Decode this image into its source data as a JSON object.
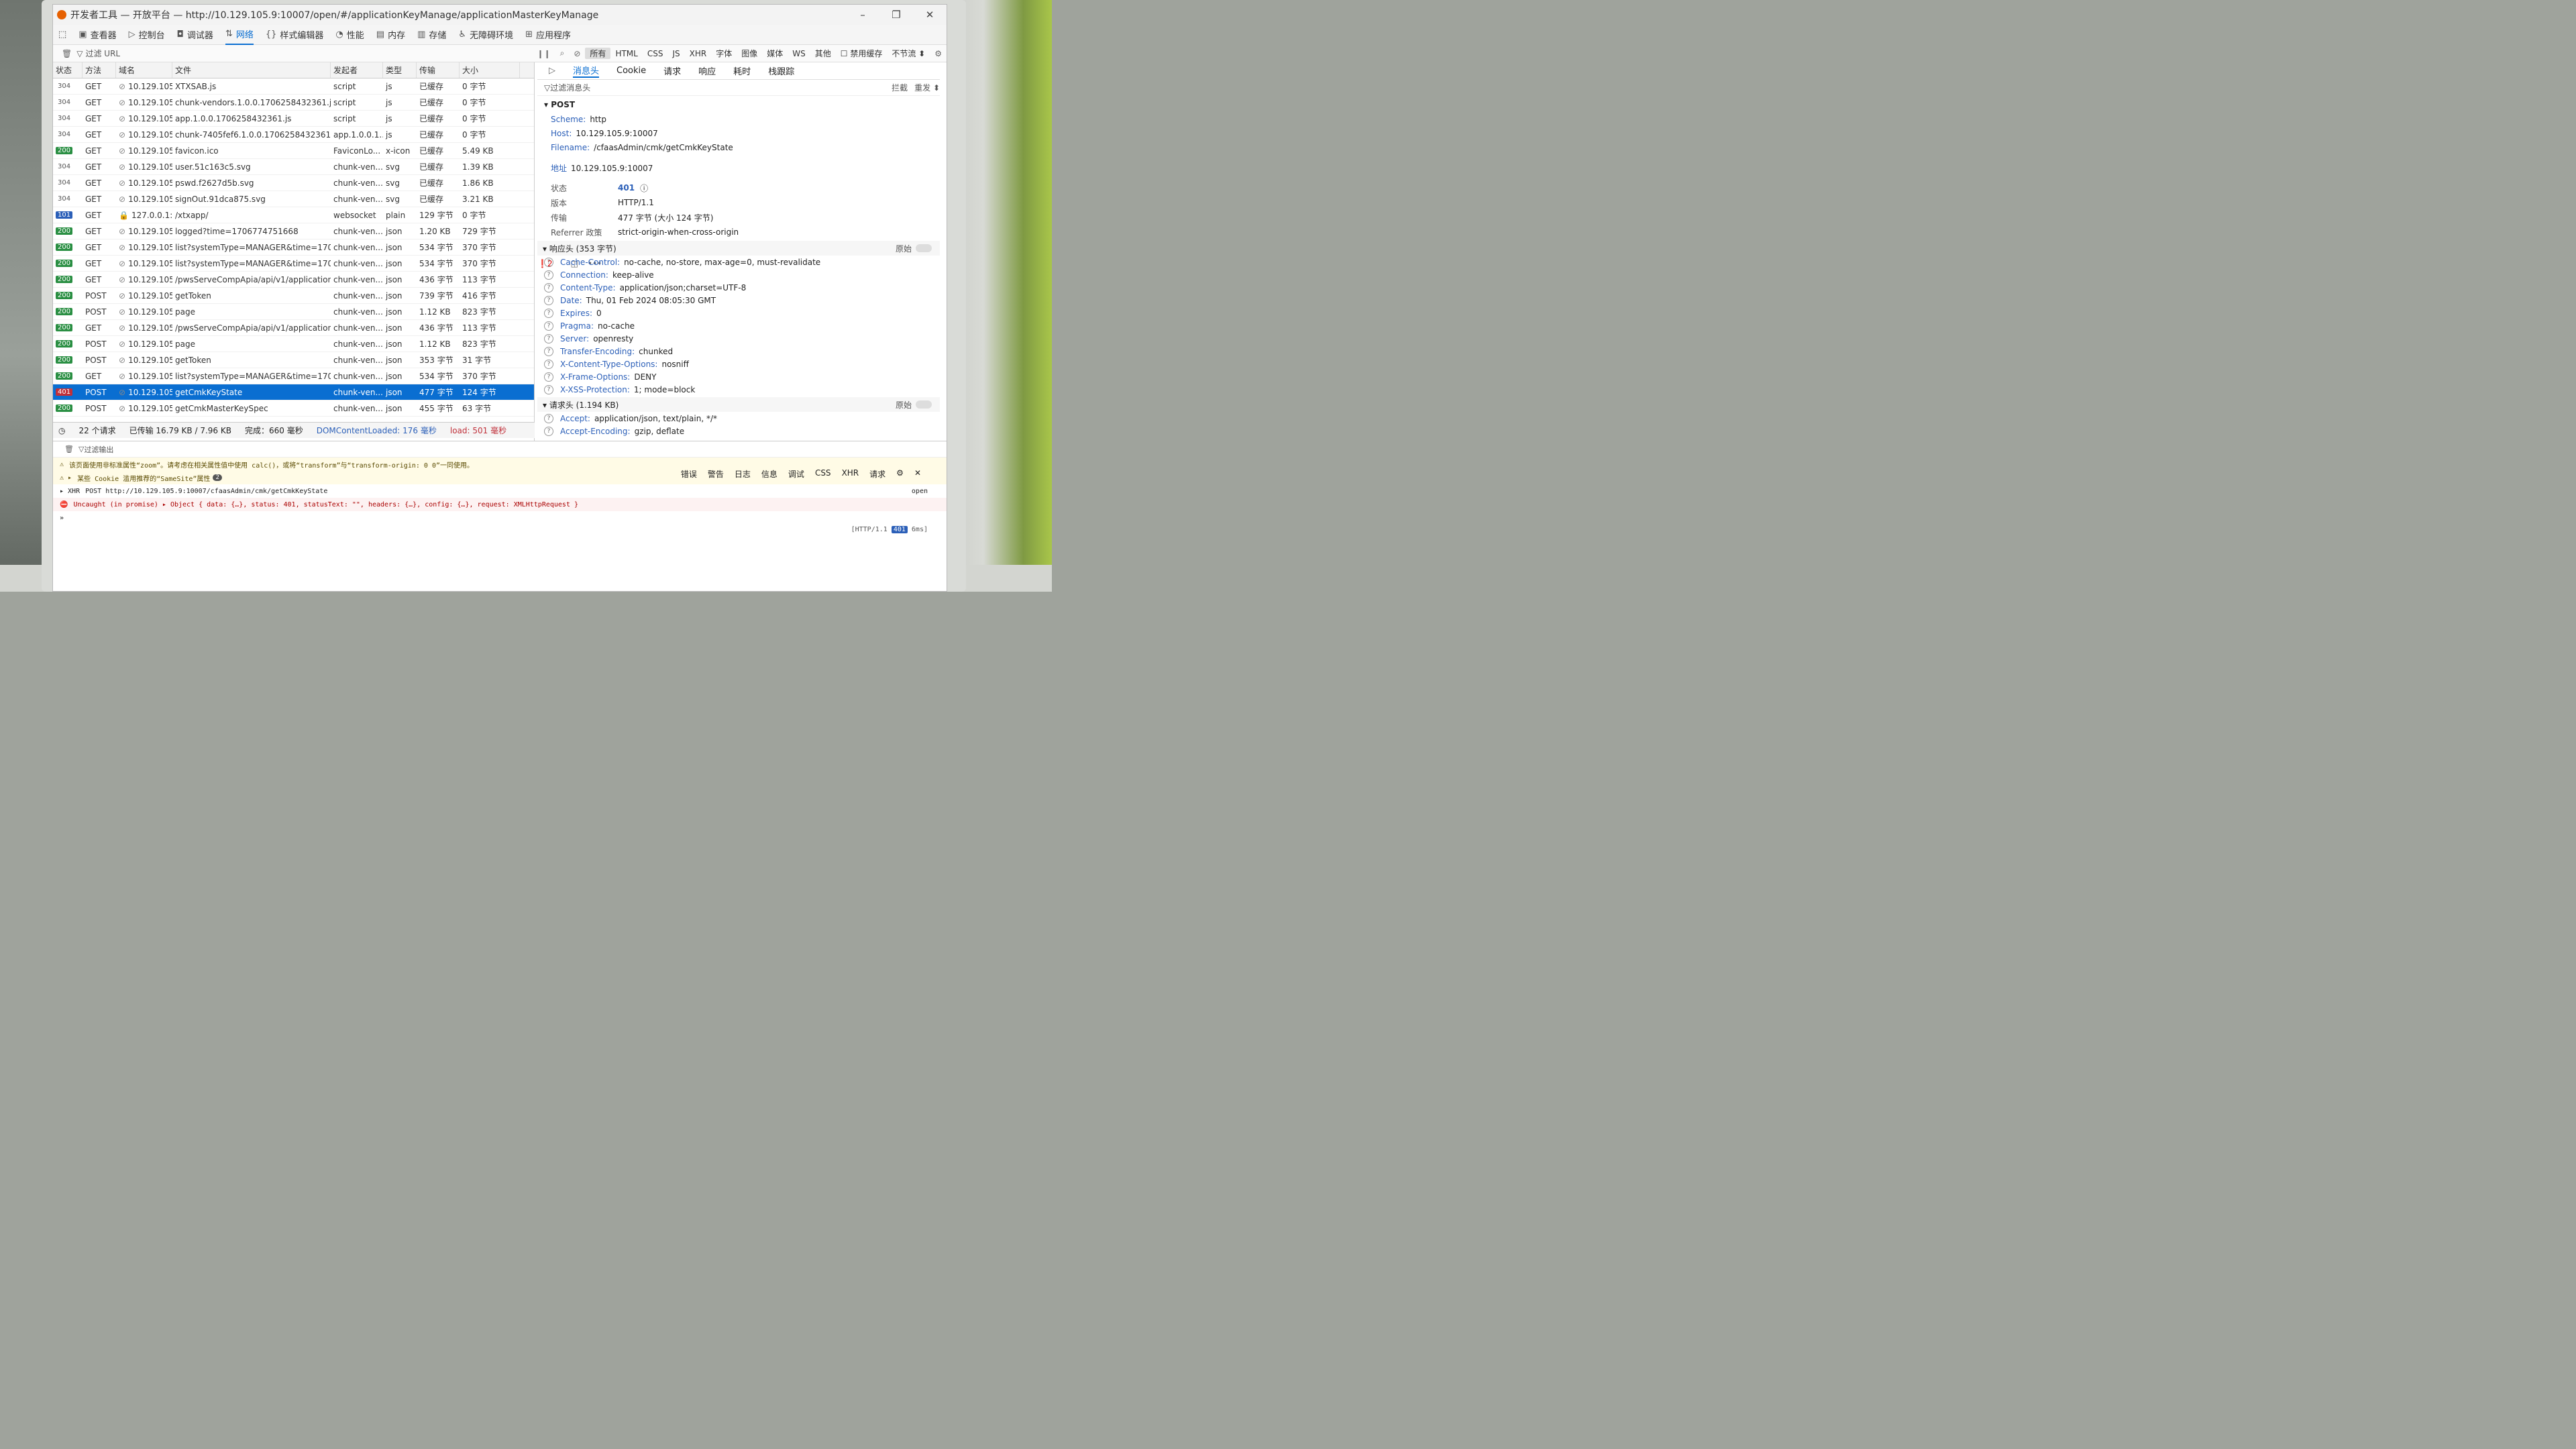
{
  "window": {
    "title": "开发者工具 — 开放平台 — http://10.129.105.9:10007/open/#/applicationKeyManage/applicationMasterKeyManage"
  },
  "toolbar": {
    "tools": [
      "查看器",
      "控制台",
      "调试器",
      "网络",
      "样式编辑器",
      "性能",
      "内存",
      "存储",
      "无障碍环境",
      "应用程序"
    ],
    "active": "网络",
    "error_count": "2"
  },
  "filterbar": {
    "placeholder": "过滤 URL",
    "types": [
      "所有",
      "HTML",
      "CSS",
      "JS",
      "XHR",
      "字体",
      "图像",
      "媒体",
      "WS",
      "其他"
    ],
    "disable_cache": "禁用缓存",
    "throttle": "不节流 ⬍"
  },
  "table": {
    "headers": [
      "状态",
      "方法",
      "域名",
      "文件",
      "发起者",
      "类型",
      "传输",
      "大小"
    ],
    "rows": [
      {
        "status": "304",
        "method": "GET",
        "domain": "10.129.105....",
        "file": "XTXSAB.js",
        "initiator": "script",
        "type": "js",
        "transfer": "已缓存",
        "size": "0 字节"
      },
      {
        "status": "304",
        "method": "GET",
        "domain": "10.129.105....",
        "file": "chunk-vendors.1.0.0.1706258432361.js",
        "initiator": "script",
        "type": "js",
        "transfer": "已缓存",
        "size": "0 字节"
      },
      {
        "status": "304",
        "method": "GET",
        "domain": "10.129.105....",
        "file": "app.1.0.0.1706258432361.js",
        "initiator": "script",
        "type": "js",
        "transfer": "已缓存",
        "size": "0 字节"
      },
      {
        "status": "304",
        "method": "GET",
        "domain": "10.129.105....",
        "file": "chunk-7405fef6.1.0.0.1706258432361.js",
        "initiator": "app.1.0.0.1...",
        "type": "js",
        "transfer": "已缓存",
        "size": "0 字节"
      },
      {
        "status": "200",
        "method": "GET",
        "domain": "10.129.105....",
        "file": "favicon.ico",
        "initiator": "FaviconLo...",
        "type": "x-icon",
        "transfer": "已缓存",
        "size": "5.49 KB"
      },
      {
        "status": "304",
        "method": "GET",
        "domain": "10.129.105....",
        "file": "user.51c163c5.svg",
        "initiator": "chunk-ven...",
        "type": "svg",
        "transfer": "已缓存",
        "size": "1.39 KB"
      },
      {
        "status": "304",
        "method": "GET",
        "domain": "10.129.105....",
        "file": "pswd.f2627d5b.svg",
        "initiator": "chunk-ven...",
        "type": "svg",
        "transfer": "已缓存",
        "size": "1.86 KB"
      },
      {
        "status": "304",
        "method": "GET",
        "domain": "10.129.105....",
        "file": "signOut.91dca875.svg",
        "initiator": "chunk-ven...",
        "type": "svg",
        "transfer": "已缓存",
        "size": "3.21 KB"
      },
      {
        "status": "101",
        "method": "GET",
        "domain": "127.0.0.1:2...",
        "file": "/xtxapp/",
        "initiator": "websocket",
        "type": "plain",
        "transfer": "129 字节",
        "size": "0 字节"
      },
      {
        "status": "200",
        "method": "GET",
        "domain": "10.129.105....",
        "file": "logged?time=1706774751668",
        "initiator": "chunk-ven...",
        "type": "json",
        "transfer": "1.20 KB",
        "size": "729 字节"
      },
      {
        "status": "200",
        "method": "GET",
        "domain": "10.129.105....",
        "file": "list?systemType=MANAGER&time=1706774",
        "initiator": "chunk-ven...",
        "type": "json",
        "transfer": "534 字节",
        "size": "370 字节"
      },
      {
        "status": "200",
        "method": "GET",
        "domain": "10.129.105....",
        "file": "list?systemType=MANAGER&time=1706774",
        "initiator": "chunk-ven...",
        "type": "json",
        "transfer": "534 字节",
        "size": "370 字节"
      },
      {
        "status": "200",
        "method": "GET",
        "domain": "10.129.105....",
        "file": "/pwsServeCompApia/api/v1/application_ms",
        "initiator": "chunk-ven...",
        "type": "json",
        "transfer": "436 字节",
        "size": "113 字节"
      },
      {
        "status": "200",
        "method": "POST",
        "domain": "10.129.105....",
        "file": "getToken",
        "initiator": "chunk-ven...",
        "type": "json",
        "transfer": "739 字节",
        "size": "416 字节"
      },
      {
        "status": "200",
        "method": "POST",
        "domain": "10.129.105....",
        "file": "page",
        "initiator": "chunk-ven...",
        "type": "json",
        "transfer": "1.12 KB",
        "size": "823 字节"
      },
      {
        "status": "200",
        "method": "GET",
        "domain": "10.129.105....",
        "file": "/pwsServeCompApia/api/v1/application_ms",
        "initiator": "chunk-ven...",
        "type": "json",
        "transfer": "436 字节",
        "size": "113 字节"
      },
      {
        "status": "200",
        "method": "POST",
        "domain": "10.129.105....",
        "file": "page",
        "initiator": "chunk-ven...",
        "type": "json",
        "transfer": "1.12 KB",
        "size": "823 字节"
      },
      {
        "status": "200",
        "method": "POST",
        "domain": "10.129.105....",
        "file": "getToken",
        "initiator": "chunk-ven...",
        "type": "json",
        "transfer": "353 字节",
        "size": "31 字节"
      },
      {
        "status": "200",
        "method": "GET",
        "domain": "10.129.105....",
        "file": "list?systemType=MANAGER&time=1706774",
        "initiator": "chunk-ven...",
        "type": "json",
        "transfer": "534 字节",
        "size": "370 字节"
      },
      {
        "status": "401",
        "method": "POST",
        "domain": "10.129.105....",
        "file": "getCmkKeyState",
        "initiator": "chunk-ven...",
        "type": "json",
        "transfer": "477 字节",
        "size": "124 字节"
      },
      {
        "status": "200",
        "method": "POST",
        "domain": "10.129.105....",
        "file": "getCmkMasterKeySpec",
        "initiator": "chunk-ven...",
        "type": "json",
        "transfer": "455 字节",
        "size": "63 字节"
      }
    ],
    "selected_index": 19
  },
  "summary": {
    "requests": "22 个请求",
    "transferred": "已传输 16.79 KB / 7.96 KB",
    "finish": "完成：660 毫秒",
    "dcl": "DOMContentLoaded: 176 毫秒",
    "load": "load: 501 毫秒"
  },
  "details": {
    "tabs": [
      "消息头",
      "Cookie",
      "请求",
      "响应",
      "耗时",
      "栈跟踪"
    ],
    "active": "消息头",
    "filter_placeholder": "过滤消息头",
    "block": "拦截",
    "resend": "重发 ⬍",
    "method": "POST",
    "scheme_k": "Scheme:",
    "scheme": "http",
    "host_k": "Host:",
    "host": "10.129.105.9:10007",
    "filename_k": "Filename:",
    "filename": "/cfaasAdmin/cmk/getCmkKeyState",
    "address_k": "地址",
    "address": "10.129.105.9:10007",
    "status_k": "状态",
    "status": "401",
    "version_k": "版本",
    "version": "HTTP/1.1",
    "transfer_k": "传输",
    "transfer": "477 字节 (大小 124 字节)",
    "referrer_k": "Referrer 政策",
    "referrer": "strict-origin-when-cross-origin",
    "resp_headers_title": "响应头 (353 字节)",
    "raw": "原始",
    "resp_headers": [
      {
        "k": "Cache-Control:",
        "v": "no-cache, no-store, max-age=0, must-revalidate"
      },
      {
        "k": "Connection:",
        "v": "keep-alive"
      },
      {
        "k": "Content-Type:",
        "v": "application/json;charset=UTF-8"
      },
      {
        "k": "Date:",
        "v": "Thu, 01 Feb 2024 08:05:30 GMT"
      },
      {
        "k": "Expires:",
        "v": "0"
      },
      {
        "k": "Pragma:",
        "v": "no-cache"
      },
      {
        "k": "Server:",
        "v": "openresty"
      },
      {
        "k": "Transfer-Encoding:",
        "v": "chunked"
      },
      {
        "k": "X-Content-Type-Options:",
        "v": "nosniff"
      },
      {
        "k": "X-Frame-Options:",
        "v": "DENY"
      },
      {
        "k": "X-XSS-Protection:",
        "v": "1; mode=block"
      }
    ],
    "req_headers_title": "请求头 (1.194 KB)",
    "req_headers": [
      {
        "k": "Accept:",
        "v": "application/json, text/plain, */*"
      },
      {
        "k": "Accept-Encoding:",
        "v": "gzip, deflate"
      }
    ]
  },
  "console": {
    "filter_placeholder": "过滤输出",
    "tabs": [
      "错误",
      "警告",
      "日志",
      "信息",
      "调试",
      "CSS",
      "XHR",
      "请求"
    ],
    "warn1": "该页面使用非标准属性“zoom”。请考虑在相关属性值中使用 calc()，或将“transform”与“transform-origin: 0 0”一同使用。",
    "warn2": "某些 Cookie 滥用推荐的“SameSite”属性",
    "warn2_count": "2",
    "xhr": "POST http://10.129.105.9:10007/cfaasAdmin/cmk/getCmkKeyState",
    "open": "open",
    "error": "Uncaught (in promise) ▸ Object { data: {…}, status: 401, statusText: \"\", headers: {…}, config: {…}, request: XMLHttpRequest }",
    "http_meta": "[HTTP/1.1",
    "http_status": "401",
    "http_time": "6ms]",
    "prompt": "»"
  },
  "colors": {
    "accent": "#0a6ed1",
    "ok": "#2a8f43",
    "error": "#c0303a"
  }
}
